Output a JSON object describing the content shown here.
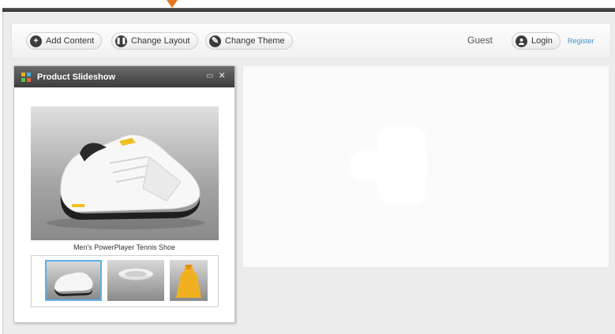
{
  "toolbar": {
    "add_content": "Add Content",
    "change_layout": "Change Layout",
    "change_theme": "Change Theme",
    "guest": "Guest",
    "login": "Login",
    "register": "Register"
  },
  "icons": {
    "add": "plus-circle-icon",
    "layout": "pause-circle-icon",
    "theme": "brush-circle-icon",
    "login": "user-circle-icon",
    "widget": "grid-logo-icon",
    "minimize": "minimize-icon",
    "close": "close-icon",
    "add_area": "plus-icon"
  },
  "widget": {
    "title": "Product Slideshow",
    "caption": "Men's PowerPlayer Tennis Shoe",
    "thumbnails": [
      "white tennis shoe",
      "white visor cap",
      "yellow tennis dress"
    ]
  },
  "colors": {
    "accent": "#3a97d4",
    "marker": "#e8771e",
    "header_dark": "#3d3d3d",
    "selected_thumb_border": "#5bb2e6"
  }
}
